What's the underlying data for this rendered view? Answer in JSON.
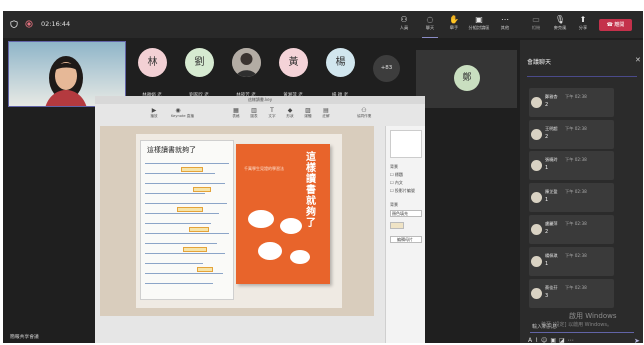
{
  "topbar": {
    "timer": "02:16:44",
    "tools": [
      {
        "name": "participants",
        "icon": "people-icon",
        "label": "人員"
      },
      {
        "name": "chat",
        "icon": "chat-icon",
        "label": "聊天"
      },
      {
        "name": "raise-hand",
        "icon": "hand-icon",
        "label": "舉手"
      },
      {
        "name": "breakout-rooms",
        "icon": "rooms-icon",
        "label": "分組討論區"
      },
      {
        "name": "more",
        "icon": "more-icon",
        "label": "其他"
      },
      {
        "name": "camera",
        "icon": "camera-icon",
        "label": "相機"
      },
      {
        "name": "mic",
        "icon": "mic-icon",
        "label": "麥克風"
      },
      {
        "name": "share",
        "icon": "share-icon",
        "label": "分享"
      }
    ],
    "leave_label": "離開"
  },
  "participants": [
    {
      "initial": "林",
      "name": "林雅娟 老",
      "color": "#f2d0d4"
    },
    {
      "initial": "劉",
      "name": "劉家欣 老",
      "color": "#d6ead1"
    },
    {
      "initial": "",
      "name": "林筱芳 老",
      "color": "#8a8a8a"
    },
    {
      "initial": "黃",
      "name": "黃湘萍 老",
      "color": "#f4d3d8"
    },
    {
      "initial": "楊",
      "name": "楊 穎 老",
      "color": "#d1e6ee"
    }
  ],
  "more_participants": "+83",
  "lone_tile_initial": "鄭",
  "chat": {
    "title": "會議聊天",
    "messages": [
      {
        "name": "鄭雅杏",
        "time": "下午 02:38",
        "body": "2"
      },
      {
        "name": "王明超",
        "time": "下午 02:38",
        "body": "2"
      },
      {
        "name": "張曉玲",
        "time": "下午 02:38",
        "body": "1"
      },
      {
        "name": "陳芷盈",
        "time": "下午 02:38",
        "body": "1"
      },
      {
        "name": "盧麗萍",
        "time": "下午 02:38",
        "body": "2"
      },
      {
        "name": "楊佩琪",
        "time": "下午 02:38",
        "body": "1"
      },
      {
        "name": "蔡佳芬",
        "time": "下午 02:38",
        "body": "3"
      }
    ],
    "input_placeholder": "輸入新訊息",
    "windows_watermark_1": "啟用 Windows",
    "windows_watermark_2": "移至 [設定] 以啟用 Windows。"
  },
  "share": {
    "window_title": "這樣讀書.key",
    "toolbar": [
      {
        "icon": "play-icon",
        "label": "播放"
      },
      {
        "icon": "keynote-icon",
        "label": "Keynote 直播"
      },
      {
        "icon": "table-icon",
        "label": "表格"
      },
      {
        "icon": "chart-icon",
        "label": "圖表"
      },
      {
        "icon": "text-icon",
        "label": "文字"
      },
      {
        "icon": "shape-icon",
        "label": "形狀"
      },
      {
        "icon": "media-icon",
        "label": "媒體"
      },
      {
        "icon": "comment-icon",
        "label": "註解"
      },
      {
        "icon": "collaborate-icon",
        "label": "協同作業"
      }
    ],
    "notebook_title": "這樣讀書就夠了",
    "book_title": "這樣讀書就夠了",
    "book_subtitle": "千萬學生見證的學習法",
    "panel": {
      "label_1": "背景",
      "label_2": "外觀",
      "opt_1": "標題",
      "opt_2": "內文",
      "opt_3": "投影片編號",
      "label_3": "背景",
      "dropdown": "顏色填充",
      "button": "編輯母片"
    }
  },
  "meeting_label": "簡報共享會議"
}
